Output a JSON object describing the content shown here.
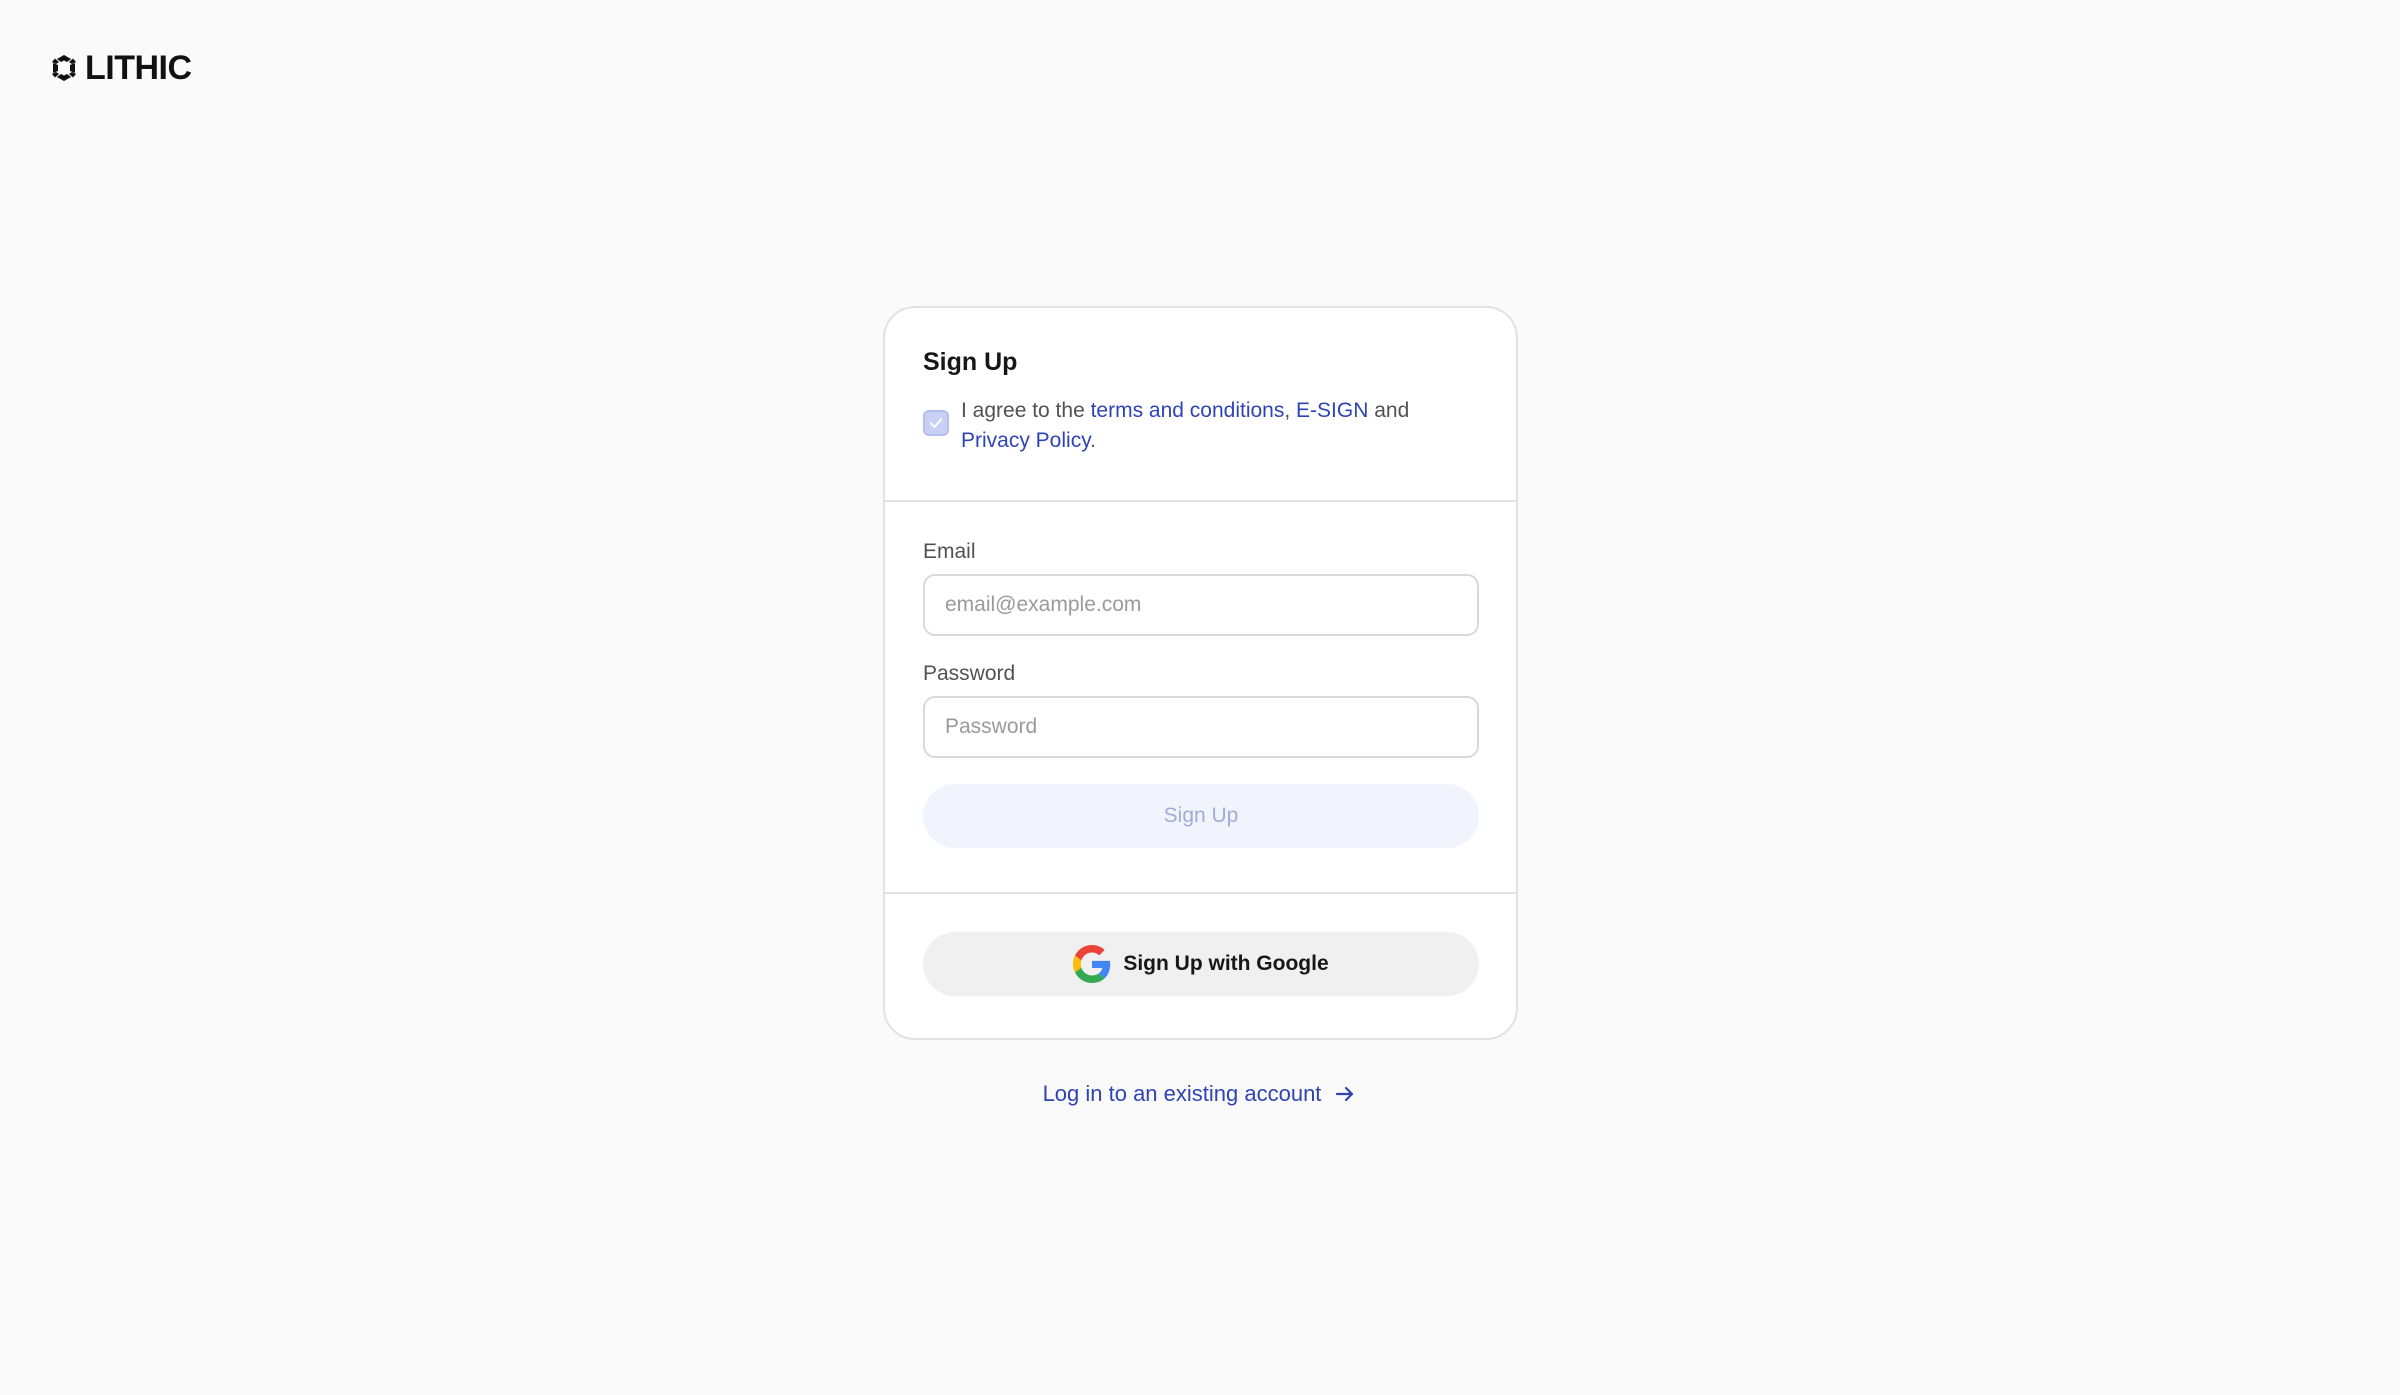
{
  "brand": {
    "name": "LITHIC",
    "logo_icon": "lithic-logo-icon"
  },
  "signup": {
    "title": "Sign Up",
    "agree": {
      "checked": true,
      "prefix": "I agree to the ",
      "terms_link": "terms and conditions",
      "comma": ", ",
      "esign_link": "E-SIGN",
      "and": " and ",
      "privacy_link": "Privacy Policy",
      "period": "."
    },
    "email": {
      "label": "Email",
      "placeholder": "email@example.com",
      "value": ""
    },
    "password": {
      "label": "Password",
      "placeholder": "Password",
      "value": ""
    },
    "submit_label": "Sign Up",
    "google_label": "Sign Up with Google"
  },
  "login_link": {
    "label": "Log in to an existing account",
    "icon": "arrow-right-icon"
  },
  "colors": {
    "link": "#2f44b3",
    "primary_button_bg": "#f2f4fd",
    "primary_button_text": "#a3acd6",
    "background": "#fafafa"
  }
}
